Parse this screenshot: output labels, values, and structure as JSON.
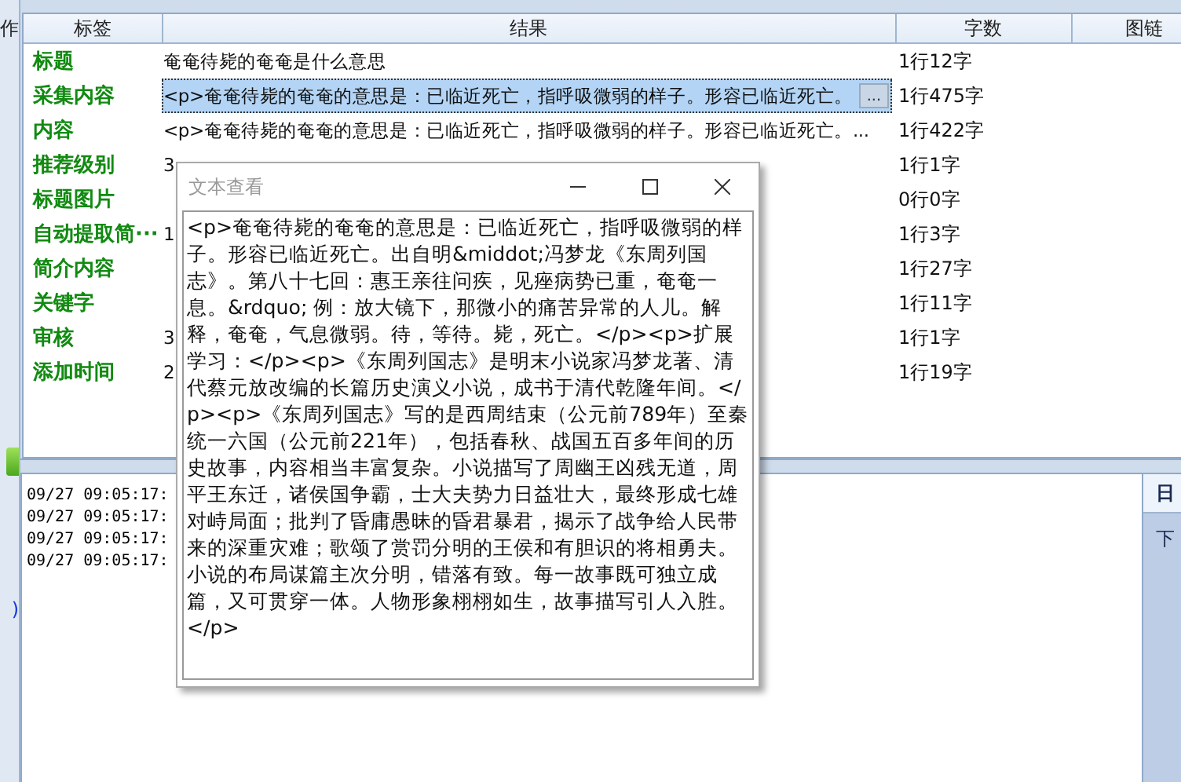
{
  "left_toolbar": {
    "label": "作",
    "mark": ")"
  },
  "grid": {
    "columns": [
      "标签",
      "结果",
      "字数",
      "图链"
    ],
    "edit_button": "...",
    "rows": [
      {
        "label": "标题",
        "result": "奄奄待毙的奄奄是什么意思",
        "count": "1行12字",
        "selected": false
      },
      {
        "label": "采集内容",
        "result": "<p>奄奄待毙的奄奄的意思是：已临近死亡，指呼吸微弱的样子。形容已临近死亡。",
        "count": "1行475字",
        "selected": true
      },
      {
        "label": "内容",
        "result": "<p>奄奄待毙的奄奄的意思是：已临近死亡，指呼吸微弱的样子。形容已临近死亡。...",
        "count": "1行422字",
        "selected": false
      },
      {
        "label": "推荐级别",
        "result": "3",
        "count": "1行1字",
        "selected": false
      },
      {
        "label": "标题图片",
        "count": "0行0字",
        "selected": false
      },
      {
        "label": "自动提取简···",
        "result": "1",
        "count": "1行3字",
        "selected": false
      },
      {
        "label": "简介内容",
        "count": "1行27字",
        "selected": false
      },
      {
        "label": "关键字",
        "count": "1行11字",
        "selected": false
      },
      {
        "label": "审核",
        "result": "3",
        "count": "1行1字",
        "selected": false
      },
      {
        "label": "添加时间",
        "result": "2",
        "count": "1行19字",
        "selected": false
      }
    ]
  },
  "dialog": {
    "title": "文本查看",
    "text": "<p>奄奄待毙的奄奄的意思是：已临近死亡，指呼吸微弱的样子。形容已临近死亡。出自明&middot;冯梦龙《东周列国志》。第八十七回：惠王亲往问疾，见痤病势已重，奄奄一息。&rdquo; 例：放大镜下，那微小的痛苦异常的人儿。解释，奄奄，气息微弱。待，等待。毙，死亡。</p><p>扩展学习：</p><p>《东周列国志》是明末小说家冯梦龙著、清代蔡元放改编的长篇历史演义小说，成书于清代乾隆年间。</p><p>《东周列国志》写的是西周结束（公元前789年）至秦统一六国（公元前221年），包括春秋、战国五百多年间的历史故事，内容相当丰富复杂。小说描写了周幽王凶残无道，周平王东迁，诸侯国争霸，士大夫势力日益壮大，最终形成七雄对峙局面；批判了昏庸愚昧的昏君暴君，揭示了战争给人民带来的深重灾难；歌颂了赏罚分明的王侯和有胆识的将相勇夫。小说的布局谋篇主次分明，错落有致。每一故事既可独立成篇，又可贯穿一体。人物形象栩栩如生，故事描写引人入胜。</p>"
  },
  "log": {
    "lines": [
      "09/27 09:05:17:",
      "09/27 09:05:17:",
      "09/27 09:05:17:",
      "09/27 09:05:17:"
    ]
  },
  "side_panel": {
    "title": "日",
    "text": "下"
  }
}
